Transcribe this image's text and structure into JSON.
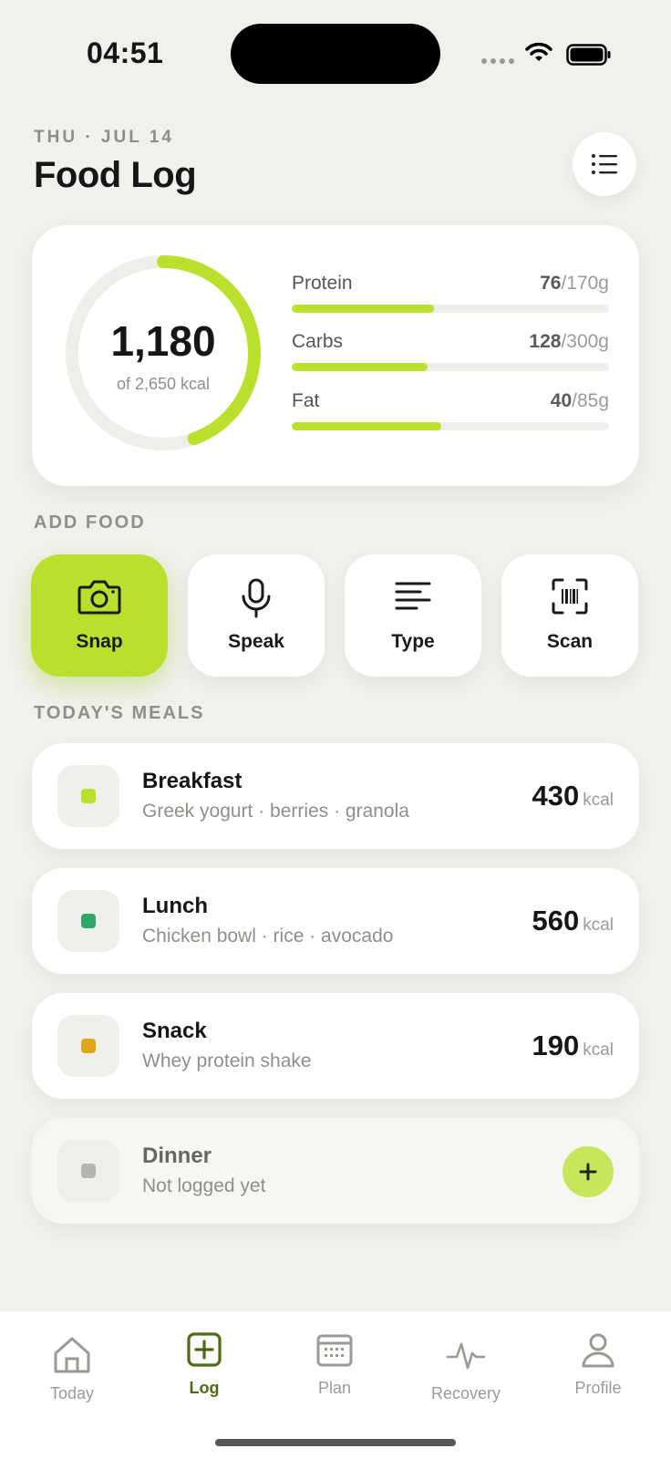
{
  "status": {
    "time": "04:51"
  },
  "header": {
    "date": "THU · JUL 14",
    "title": "Food Log"
  },
  "summary": {
    "calories": "1,180",
    "calories_sub": "of 2,650 kcal",
    "progress": 0.445,
    "macros": [
      {
        "label": "Protein",
        "value": "76",
        "goal": "/170g",
        "fraction": 0.447
      },
      {
        "label": "Carbs",
        "value": "128",
        "goal": "/300g",
        "fraction": 0.427
      },
      {
        "label": "Fat",
        "value": "40",
        "goal": "/85g",
        "fraction": 0.471
      }
    ]
  },
  "add_food": {
    "label": "ADD FOOD",
    "tiles": [
      {
        "label": "Snap",
        "icon": "camera-icon"
      },
      {
        "label": "Speak",
        "icon": "microphone-icon"
      },
      {
        "label": "Type",
        "icon": "text-lines-icon"
      },
      {
        "label": "Scan",
        "icon": "barcode-scan-icon"
      }
    ]
  },
  "meals": {
    "label": "TODAY'S MEALS",
    "items": [
      {
        "name": "Breakfast",
        "desc": "Greek yogurt · berries · granola",
        "kcal": "430",
        "unit": "kcal",
        "color": "#b8e02c"
      },
      {
        "name": "Lunch",
        "desc": "Chicken bowl · rice · avocado",
        "kcal": "560",
        "unit": "kcal",
        "color": "#2ea86a"
      },
      {
        "name": "Snack",
        "desc": "Whey protein shake",
        "kcal": "190",
        "unit": "kcal",
        "color": "#e0a615"
      },
      {
        "name": "Dinner",
        "desc": "Not logged yet",
        "color": "#b5b5b0"
      }
    ]
  },
  "tabs": [
    {
      "label": "Today",
      "icon": "home-icon"
    },
    {
      "label": "Log",
      "icon": "plus-square-icon",
      "active": true
    },
    {
      "label": "Plan",
      "icon": "calendar-icon"
    },
    {
      "label": "Recovery",
      "icon": "pulse-icon"
    },
    {
      "label": "Profile",
      "icon": "person-icon"
    }
  ],
  "colors": {
    "accent": "#b8e02c",
    "background": "#f1f0ed",
    "active_tab": "#4c6b16"
  }
}
